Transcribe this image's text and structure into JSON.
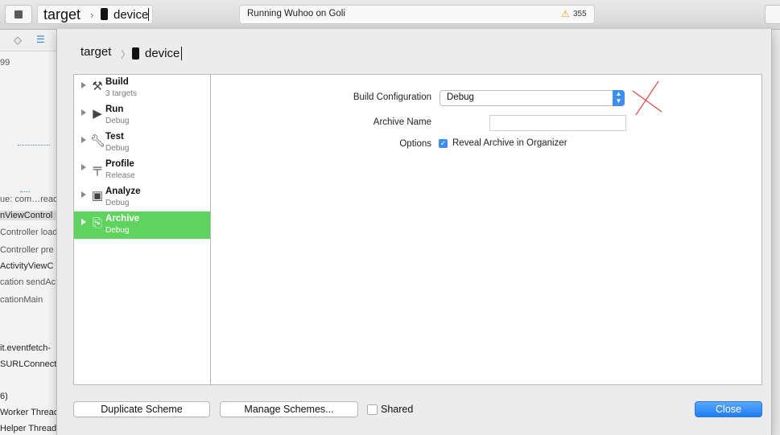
{
  "toolbar": {
    "scheme_target": "target",
    "scheme_device": "device",
    "activity_text": "Running Wuhoo on Goli",
    "warning_count": "355"
  },
  "background_sidebar": {
    "lines": [
      "99",
      "ue: com…read",
      "nViewControl",
      "Controller load",
      "Controller pre",
      "ActivityViewC",
      "cation sendAc",
      "cationMain",
      "it.eventfetch-",
      "SURLConnecti",
      "6)",
      "Worker Thread",
      "Helper Thread"
    ]
  },
  "sheet": {
    "target": "target",
    "device": "device",
    "actions": [
      {
        "name": "Build",
        "sub": "3 targets",
        "icon": "hammer-icon"
      },
      {
        "name": "Run",
        "sub": "Debug",
        "icon": "play-icon"
      },
      {
        "name": "Test",
        "sub": "Debug",
        "icon": "wrench-icon"
      },
      {
        "name": "Profile",
        "sub": "Release",
        "icon": "caliper-icon"
      },
      {
        "name": "Analyze",
        "sub": "Debug",
        "icon": "analyze-icon"
      },
      {
        "name": "Archive",
        "sub": "Debug",
        "icon": "archive-icon"
      }
    ],
    "selected_action": "Archive",
    "detail": {
      "build_config_label": "Build Configuration",
      "build_config_value": "Debug",
      "archive_name_label": "Archive Name",
      "archive_name_value": "",
      "options_label": "Options",
      "reveal_label": "Reveal Archive in Organizer",
      "reveal_checked": true
    },
    "footer": {
      "duplicate_label": "Duplicate Scheme",
      "manage_label": "Manage Schemes...",
      "shared_label": "Shared",
      "shared_checked": false,
      "close_label": "Close"
    }
  },
  "colors": {
    "selection": "#5ed45e",
    "accent": "#1f7cf0",
    "annotation": "#e0463c"
  }
}
